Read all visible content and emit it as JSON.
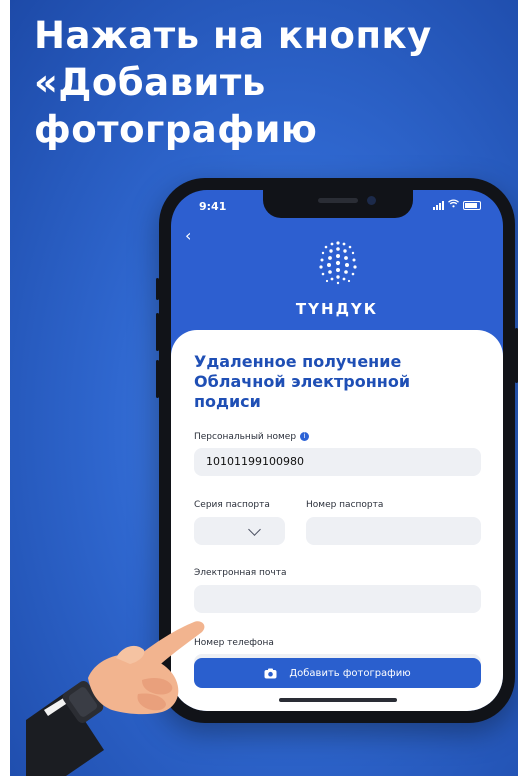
{
  "headline": {
    "line1": "Нажать на кнопку",
    "line2": "«Добавить",
    "line3": "фотографию"
  },
  "status_bar": {
    "time": "9:41"
  },
  "app": {
    "brand": "ТҮНДҮК"
  },
  "form": {
    "title_line1": "Удаленное получение",
    "title_line2": "Облачной электронной",
    "title_line3": "подиси",
    "personal_number_label": "Персональный номер",
    "personal_number_value": "10101199100980",
    "passport_series_label": "Серия паспорта",
    "passport_number_label": "Номер паспорта",
    "email_label": "Электронная почта",
    "phone_label": "Номер телефона",
    "add_photo_button": "Добавить фотографию"
  },
  "colors": {
    "background": "#2f67cf",
    "accent": "#2a5fce",
    "title": "#1f4fb5"
  },
  "icons": [
    "back-chevron-icon",
    "info-icon",
    "chevron-down-icon",
    "camera-icon",
    "signal-icon",
    "wifi-icon",
    "battery-icon"
  ]
}
